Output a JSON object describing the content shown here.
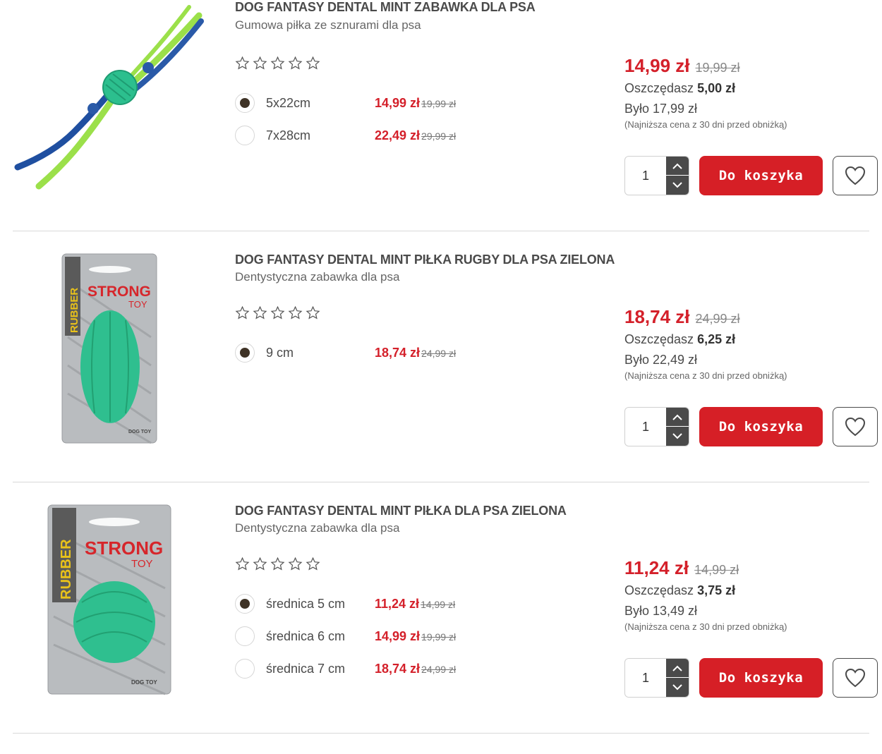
{
  "products": [
    {
      "title": "DOG FANTASY DENTAL MINT ZABAWKA DLA PSA",
      "subtitle": "Gumowa piłka ze sznurami dla psa",
      "image": "rope-ball-toy",
      "rating": 0,
      "variants": [
        {
          "label": "5x22cm",
          "price": "14,99 zł",
          "old_price": "19,99 zł",
          "selected": true
        },
        {
          "label": "7x28cm",
          "price": "22,49 zł",
          "old_price": "29,99 zł",
          "selected": false
        }
      ],
      "price": "14,99 zł",
      "old_price": "19,99 zł",
      "save_label": "Oszczędasz",
      "save_value": "5,00 zł",
      "was": "Było 17,99 zł",
      "lowest_note": "(Najniższa cena z 30 dni przed obniżką)",
      "qty": "1",
      "cart_label": "Do koszyka"
    },
    {
      "title": "DOG FANTASY DENTAL MINT PIŁKA RUGBY DLA PSA ZIELONA",
      "subtitle": "Dentystyczna zabawka dla psa",
      "image": "rugby-ball-toy",
      "rating": 0,
      "variants": [
        {
          "label": "9 cm",
          "price": "18,74 zł",
          "old_price": "24,99 zł",
          "selected": true
        }
      ],
      "price": "18,74 zł",
      "old_price": "24,99 zł",
      "save_label": "Oszczędasz",
      "save_value": "6,25 zł",
      "was": "Było 22,49 zł",
      "lowest_note": "(Najniższa cena z 30 dni przed obniżką)",
      "qty": "1",
      "cart_label": "Do koszyka"
    },
    {
      "title": "DOG FANTASY DENTAL MINT PIŁKA DLA PSA ZIELONA",
      "subtitle": "Dentystyczna zabawka dla psa",
      "image": "round-ball-toy",
      "rating": 0,
      "variants": [
        {
          "label": "średnica 5 cm",
          "price": "11,24 zł",
          "old_price": "14,99 zł",
          "selected": true
        },
        {
          "label": "średnica 6 cm",
          "price": "14,99 zł",
          "old_price": "19,99 zł",
          "selected": false
        },
        {
          "label": "średnica 7 cm",
          "price": "18,74 zł",
          "old_price": "24,99 zł",
          "selected": false
        }
      ],
      "price": "11,24 zł",
      "old_price": "14,99 zł",
      "save_label": "Oszczędasz",
      "save_value": "3,75 zł",
      "was": "Było 13,49 zł",
      "lowest_note": "(Najniższa cena z 30 dni przed obniżką)",
      "qty": "1",
      "cart_label": "Do koszyka"
    }
  ],
  "packaging": {
    "brand_text": "STRONG",
    "toy_text": "TOY",
    "side_text": "RUBBER",
    "corner_text": "DOG TOY"
  },
  "colors": {
    "accent_red": "#d61f26",
    "price_red": "#d4202a",
    "radio_fill": "#3f3326",
    "toy_mint": "#2fbf8f"
  }
}
